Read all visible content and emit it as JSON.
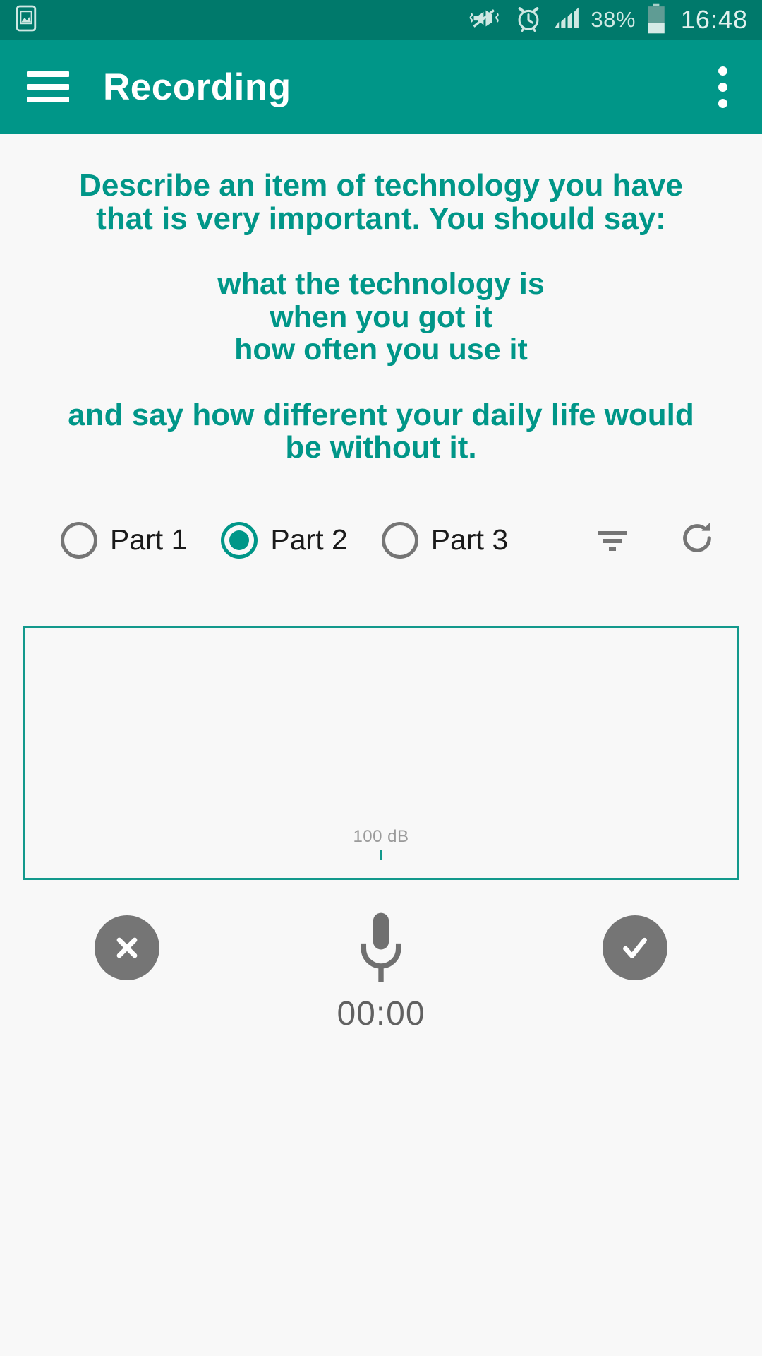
{
  "status_bar": {
    "left_icons": [
      {
        "name": "screenshot-image-icon",
        "glyph": "image"
      }
    ],
    "right_icons": [
      {
        "name": "vibrate-mute-icon",
        "glyph": "mute-vibrate"
      },
      {
        "name": "alarm-clock-icon",
        "glyph": "alarm"
      },
      {
        "name": "signal-strength-icon",
        "glyph": "signal"
      }
    ],
    "battery_percent": "38%",
    "battery_icon": "battery-icon",
    "clock": "16:48",
    "background_color": "#00796b"
  },
  "app_bar": {
    "menu_icon": "hamburger-menu-icon",
    "title": "Recording",
    "overflow_icon": "overflow-menu-icon",
    "background_color": "#009688",
    "title_color": "#ffffff"
  },
  "prompt": {
    "accent_color": "#009688",
    "intro_line_1": "Describe an item of technology you have",
    "intro_line_2": "that is very important. You should say:",
    "bullets": [
      "what the technology is",
      "when you got it",
      "how often you use it"
    ],
    "closing_line_1": "and say how different your daily life would",
    "closing_line_2": "be without it."
  },
  "parts_selector": {
    "options": [
      {
        "label": "Part 1",
        "selected": false
      },
      {
        "label": "Part 2",
        "selected": true
      },
      {
        "label": "Part 3",
        "selected": false
      }
    ],
    "selected_value": "Part 2",
    "selected_color": "#009688",
    "unselected_color": "#757575",
    "actions": [
      {
        "name": "filter-sort-icon",
        "label": "filter"
      },
      {
        "name": "refresh-icon",
        "label": "refresh"
      }
    ]
  },
  "waveform": {
    "db_label": "100 dB",
    "border_color": "#13998c",
    "tick_color": "#13998c"
  },
  "controls": {
    "cancel_label": "cancel-recording",
    "record_label": "record-microphone",
    "confirm_label": "confirm-recording",
    "button_color": "#757575",
    "timer": "00:00",
    "timer_color": "#616161"
  }
}
